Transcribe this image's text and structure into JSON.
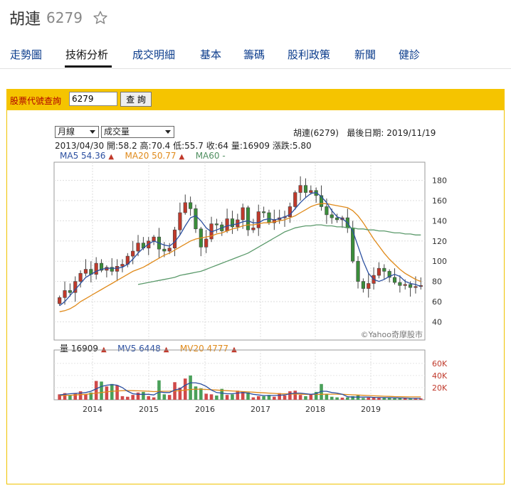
{
  "header": {
    "stock_name": "胡連",
    "stock_code": "6279"
  },
  "tabs": [
    "走勢圖",
    "技術分析",
    "成交明細",
    "基本",
    "籌碼",
    "股利政策",
    "新聞",
    "健診"
  ],
  "active_tab": "技術分析",
  "query": {
    "label": "股票代號查詢",
    "value": "6279",
    "button": "查 詢"
  },
  "selects": {
    "period": "月線",
    "indicator": "成交量"
  },
  "info": {
    "company": "胡連(6279)",
    "latest_date_label": "最後日期:",
    "latest_date": "2019/11/19",
    "ohlc_line": "2013/04/30 開:58.2 高:70.4 低:55.7 收:64 量:16909 漲跌:5.80"
  },
  "ma_legend": {
    "ma5": "MA5 54.36",
    "ma20": "MA20 50.77",
    "ma60": "MA60 -"
  },
  "vol_legend": {
    "vol": "量 16909",
    "mv5": "MV5 6448",
    "mv20": "MV20 4777"
  },
  "colors": {
    "up": "#c0392b",
    "down": "#3a8d3a",
    "ma5": "#2b4fa0",
    "ma20": "#e08a1a",
    "ma60": "#5b9a6b",
    "accent": "#f5c400"
  },
  "watermark": "©Yahoo奇摩股市",
  "chart_data": {
    "type": "candlestick",
    "x_ticks": [
      "2014",
      "2015",
      "2016",
      "2017",
      "2018",
      "2019"
    ],
    "price_axis": {
      "ticks": [
        40,
        60,
        80,
        100,
        120,
        140,
        160,
        180
      ],
      "range": [
        22,
        198
      ]
    },
    "volume_axis": {
      "ticks": [
        "60K",
        "40K",
        "20K"
      ],
      "tick_values": [
        60000,
        40000,
        20000
      ],
      "range": [
        0,
        82000
      ]
    },
    "closes": [
      64,
      71,
      69,
      80,
      88,
      92,
      87,
      98,
      91,
      94,
      90,
      95,
      97,
      105,
      110,
      118,
      113,
      120,
      124,
      112,
      110,
      113,
      131,
      148,
      158,
      152,
      132,
      114,
      122,
      137,
      136,
      130,
      142,
      134,
      141,
      153,
      131,
      133,
      149,
      148,
      138,
      141,
      143,
      144,
      154,
      168,
      175,
      168,
      170,
      165,
      154,
      146,
      143,
      141,
      143,
      133,
      100,
      80,
      73,
      78,
      86,
      93,
      90,
      84,
      79,
      76,
      77,
      74,
      75,
      76
    ],
    "ma5": [
      56,
      60,
      66,
      72,
      78,
      84,
      87,
      90,
      92,
      93,
      93,
      93,
      94,
      97,
      102,
      108,
      113,
      117,
      120,
      118,
      116,
      115,
      119,
      126,
      135,
      143,
      145,
      140,
      133,
      129,
      131,
      133,
      135,
      136,
      137,
      139,
      140,
      138,
      138,
      141,
      142,
      141,
      142,
      144,
      146,
      152,
      158,
      163,
      167,
      168,
      164,
      158,
      150,
      144,
      142,
      138,
      130,
      115,
      100,
      88,
      82,
      80,
      82,
      85,
      87,
      85,
      80,
      78,
      77,
      75
    ],
    "ma20": [
      50,
      51,
      53,
      56,
      60,
      63,
      66,
      69,
      72,
      75,
      78,
      81,
      84,
      87,
      90,
      92,
      94,
      97,
      100,
      103,
      106,
      108,
      111,
      114,
      117,
      120,
      122,
      123,
      124,
      125,
      127,
      128,
      130,
      132,
      133,
      135,
      136,
      136,
      137,
      138,
      138,
      139,
      140,
      141,
      143,
      145,
      148,
      151,
      154,
      156,
      157,
      157,
      156,
      155,
      154,
      153,
      150,
      145,
      138,
      130,
      122,
      115,
      108,
      102,
      97,
      92,
      88,
      85,
      82,
      80
    ],
    "ma60_start_index": 15,
    "ma60": [
      77,
      78,
      79,
      80,
      81,
      82,
      83,
      84,
      86,
      87,
      88,
      89,
      90,
      92,
      94,
      96,
      98,
      100,
      102,
      104,
      106,
      108,
      111,
      114,
      117,
      120,
      123,
      126,
      129,
      131,
      133,
      134,
      135,
      135,
      136,
      136,
      135,
      135,
      134,
      134,
      133,
      133,
      132,
      132,
      131,
      131,
      130,
      130,
      129,
      128,
      128,
      127,
      127,
      126,
      126
    ],
    "volume": [
      9000,
      11000,
      8000,
      10000,
      14000,
      9000,
      12000,
      31000,
      30000,
      22000,
      26000,
      24000,
      6000,
      5000,
      8000,
      12000,
      13000,
      6000,
      4000,
      32000,
      9000,
      8000,
      29000,
      20000,
      35000,
      40000,
      22000,
      19000,
      10000,
      9000,
      7000,
      18000,
      8000,
      9000,
      15000,
      13000,
      12000,
      4000,
      6000,
      6000,
      8000,
      5000,
      11000,
      7000,
      14000,
      15000,
      8000,
      6000,
      9000,
      13000,
      26000,
      10000,
      5000,
      4000,
      3500,
      4000,
      6000,
      7000,
      3000,
      3500,
      4500,
      3000,
      4000,
      3500,
      2500,
      3000,
      2500,
      2000,
      2500,
      2200
    ],
    "mv5": [
      8000,
      9000,
      10000,
      10500,
      11000,
      12000,
      14000,
      18000,
      22000,
      24000,
      25000,
      24000,
      20000,
      14000,
      10000,
      9000,
      9000,
      9000,
      8000,
      13000,
      12000,
      12000,
      16000,
      18000,
      24000,
      28000,
      28000,
      26000,
      22000,
      16000,
      12000,
      11000,
      10000,
      10000,
      11000,
      12000,
      11000,
      9000,
      8000,
      7000,
      7000,
      7000,
      7500,
      8000,
      10000,
      11000,
      11000,
      10000,
      9000,
      10000,
      14000,
      14000,
      12000,
      11000,
      9000,
      5000,
      4500,
      4500,
      4500,
      4500,
      4000,
      3600,
      3600,
      3500,
      3300,
      3000,
      2800,
      2500,
      2400,
      2300
    ],
    "mv20": [
      7000,
      7200,
      7500,
      8000,
      8500,
      9000,
      10000,
      11000,
      12000,
      13000,
      14000,
      14500,
      15000,
      15200,
      15000,
      14800,
      14500,
      14000,
      13500,
      13800,
      14000,
      14200,
      14500,
      15000,
      16000,
      17000,
      17500,
      17500,
      17000,
      16500,
      16000,
      15500,
      15000,
      14500,
      14000,
      13500,
      13000,
      12500,
      12000,
      11500,
      11000,
      10500,
      10000,
      9800,
      9600,
      9400,
      9200,
      9000,
      8900,
      8800,
      9000,
      9200,
      9300,
      9200,
      9000,
      8600,
      8200,
      7800,
      7400,
      7000,
      6600,
      6200,
      5900,
      5600,
      5300,
      5100,
      4900,
      4800,
      4780,
      4777
    ]
  }
}
